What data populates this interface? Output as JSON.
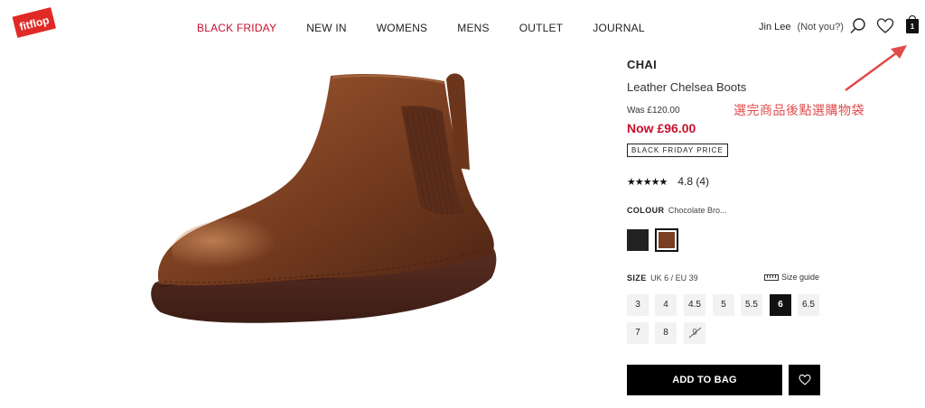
{
  "brand": {
    "logo_text": "fitflop",
    "logo_color": "#e02a26"
  },
  "nav": {
    "items": [
      {
        "label": "BLACK FRIDAY",
        "color": "#c8102e"
      },
      {
        "label": "NEW IN"
      },
      {
        "label": "WOMENS"
      },
      {
        "label": "MENS"
      },
      {
        "label": "OUTLET"
      },
      {
        "label": "JOURNAL"
      }
    ]
  },
  "header": {
    "user_name": "Jin Lee",
    "not_you": "(Not you?)",
    "icons": [
      "search-icon",
      "heart-icon",
      "bag-icon"
    ],
    "bag_count": "1"
  },
  "annotation": {
    "text": "選完商品後點選購物袋",
    "color": "#e14b4b"
  },
  "product": {
    "name": "CHAI",
    "subtitle": "Leather Chelsea Boots",
    "was_price": "Was £120.00",
    "now_price": "Now £96.00",
    "badge": "BLACK FRIDAY PRICE",
    "stars": "★★★★★",
    "rating": "4.8 (4)",
    "colour_label": "COLOUR",
    "colour_value": "Chocolate Bro...",
    "swatches": [
      {
        "name": "Black",
        "hex": "#222222"
      },
      {
        "name": "Chocolate Brown",
        "hex": "#7a3e22",
        "selected": true
      }
    ],
    "size_label": "SIZE",
    "size_value": "UK 6 / EU 39",
    "size_guide": "Size guide",
    "sizes": [
      "3",
      "4",
      "4.5",
      "5",
      "5.5",
      "6",
      "6.5",
      "7",
      "8",
      "9"
    ],
    "selected_size": "6",
    "unavailable_sizes": [
      "9"
    ],
    "add_to_bag": "ADD TO BAG"
  },
  "colors": {
    "accent_red": "#c8102e",
    "button_black": "#000000",
    "boot_brown": "#7a3e22"
  }
}
